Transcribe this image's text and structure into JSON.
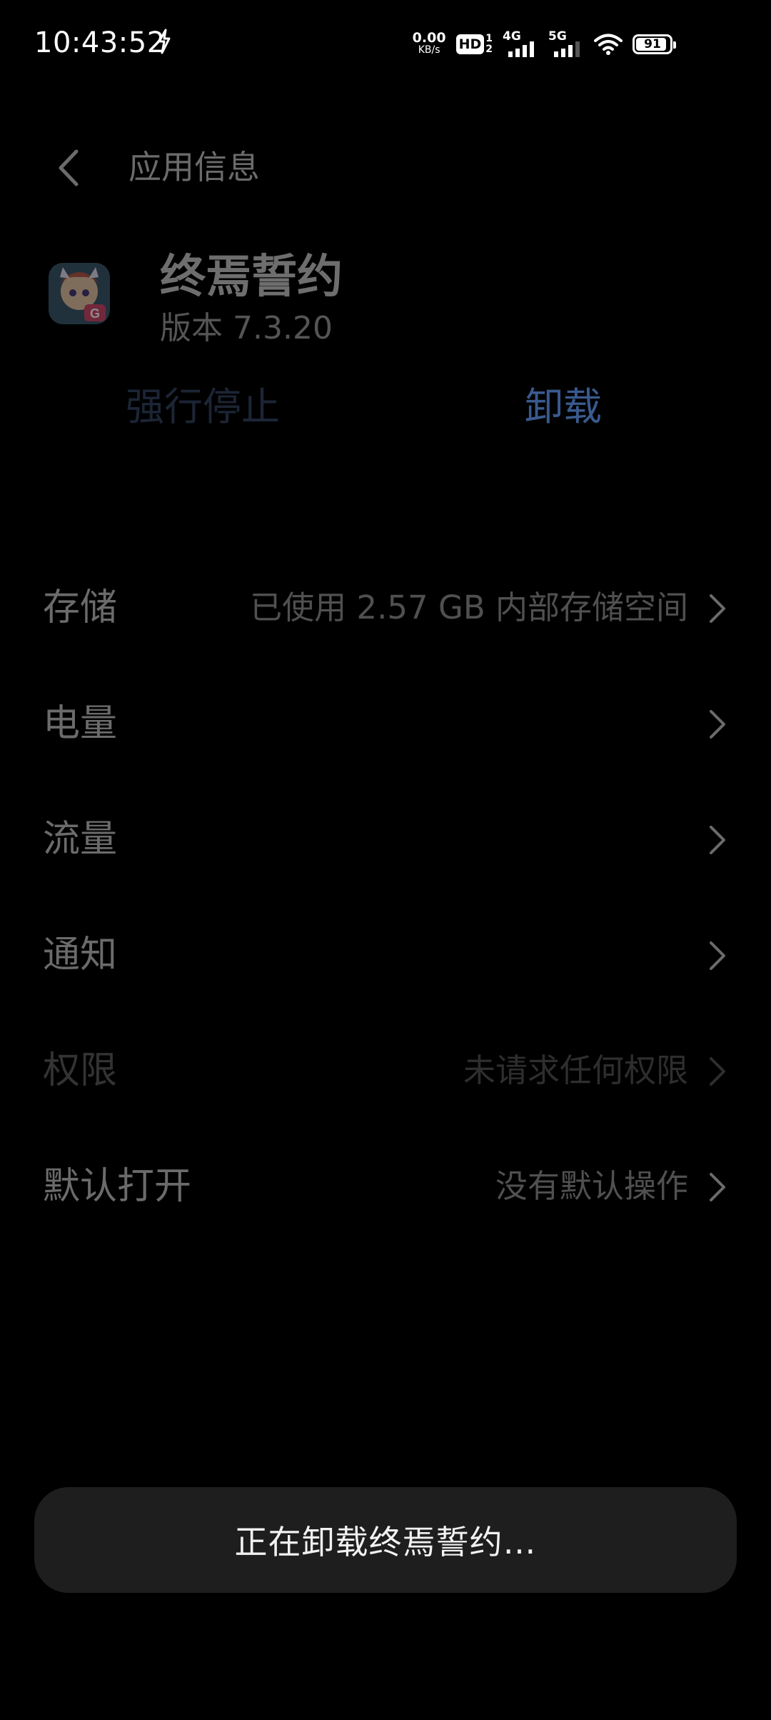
{
  "status_bar": {
    "time": "10:43:52",
    "net_speed_value": "0.00",
    "net_speed_unit": "KB/s",
    "hd_label": "HD",
    "hd_sim1": "1",
    "hd_sim2": "2",
    "signal1_label": "4G",
    "signal2_label": "5G",
    "battery_level": "91",
    "battery_fraction": 0.91
  },
  "header": {
    "title": "应用信息",
    "back_icon": "chevron-left-icon"
  },
  "app": {
    "name": "终焉誓约",
    "version": "版本 7.3.20"
  },
  "actions": {
    "force_stop": "强行停止",
    "uninstall": "卸载"
  },
  "settings": [
    {
      "label": "存储",
      "value": "已使用 2.57 GB 内部存储空间",
      "disabled": false
    },
    {
      "label": "电量",
      "value": "",
      "disabled": false
    },
    {
      "label": "流量",
      "value": "",
      "disabled": false
    },
    {
      "label": "通知",
      "value": "",
      "disabled": false
    },
    {
      "label": "权限",
      "value": "未请求任何权限",
      "disabled": true
    },
    {
      "label": "默认打开",
      "value": "没有默认操作",
      "disabled": false
    }
  ],
  "toast": {
    "text": "正在卸载终焉誓约…"
  },
  "colors": {
    "background": "#000000",
    "accent_uninstall": "#3a5a8f",
    "toast_background": "#1e1e1e"
  }
}
